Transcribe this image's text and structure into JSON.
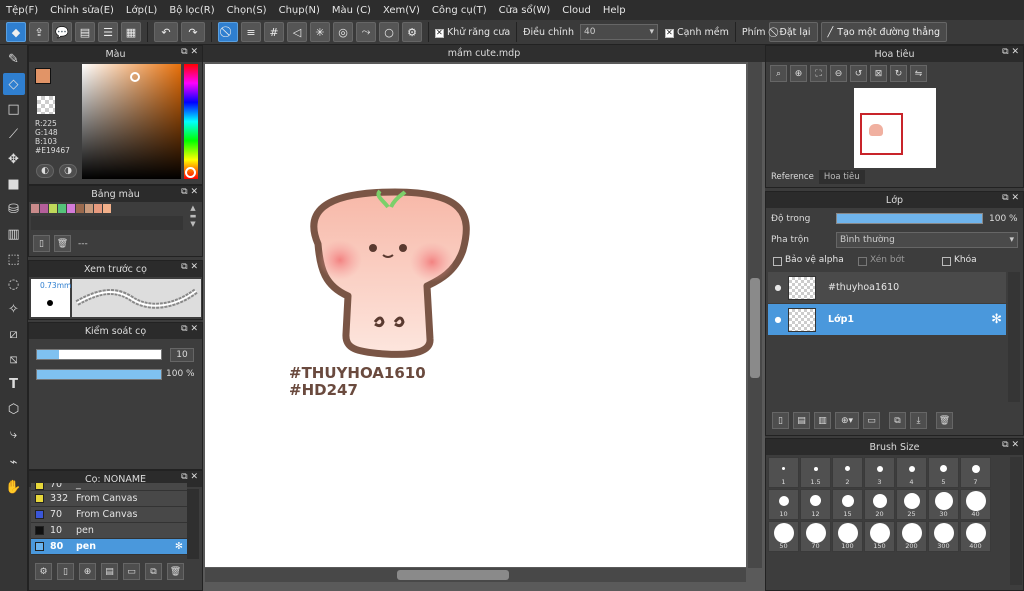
{
  "menu": [
    "Tệp(F)",
    "Chỉnh sửa(E)",
    "Lớp(L)",
    "Bộ lọc(R)",
    "Chọn(S)",
    "Chụp(N)",
    "Màu (C)",
    "Xem(V)",
    "Công cụ(T)",
    "Cửa sổ(W)",
    "Cloud",
    "Help"
  ],
  "toolbar": {
    "antialias_label": "Khử răng cưa",
    "adjust_label": "Điều chỉnh",
    "adjust_value": "40",
    "softedge_label": "Cạnh mềm",
    "keys_label": "Phím",
    "reset_label": "Đặt lại",
    "straight_label": "Tạo một đường thẳng"
  },
  "color_panel": {
    "title": "Màu",
    "r": "R:225",
    "g": "G:148",
    "b": "B:103",
    "hex": "#E19467",
    "fg_color": "#e19467"
  },
  "palette": {
    "title": "Bảng màu",
    "swatches": [
      "#c98a8a",
      "#b45f9a",
      "#c0d85a",
      "#55c37a",
      "#d37bd8",
      "#9a6a4e",
      "#c99a7c",
      "#e79a7e",
      "#f2b08a"
    ],
    "footer_text": "---"
  },
  "brush_preview": {
    "title": "Xem trước cọ",
    "size": "0.73mm"
  },
  "brush_control": {
    "title": "Kiểm soát cọ",
    "size_value": "10",
    "opacity_value": "100 %"
  },
  "brush_list": {
    "title": "Cọ: NONAME",
    "items": [
      {
        "color": "#e8d83a",
        "size": "70",
        "name": "_"
      },
      {
        "color": "#e8d83a",
        "size": "332",
        "name": "From Canvas"
      },
      {
        "color": "#3a56d8",
        "size": "70",
        "name": "From Canvas"
      },
      {
        "color": "#111111",
        "size": "10",
        "name": "pen"
      },
      {
        "color": "#6ab4f0",
        "size": "80",
        "name": "pen"
      }
    ]
  },
  "document": {
    "tab": "mầm cute.mdp",
    "text1": "#THUYHOA1610",
    "text2": "#HD247"
  },
  "navigator": {
    "title": "Hoa tiêu",
    "tab_reference": "Reference",
    "tab_navigator": "Hoa tiêu"
  },
  "layers": {
    "title": "Lớp",
    "opacity_label": "Độ trong",
    "opacity_value": "100 %",
    "blend_label": "Pha trộn",
    "blend_value": "Bình thường",
    "protect_alpha": "Bảo vệ alpha",
    "clipping": "Xén bớt",
    "lock": "Khóa",
    "items": [
      {
        "name": "#thuyhoa1610",
        "selected": false
      },
      {
        "name": "Lớp1",
        "selected": true
      }
    ]
  },
  "brush_size": {
    "title": "Brush Size",
    "sizes": [
      "1",
      "1.5",
      "2",
      "3",
      "4",
      "5",
      "7",
      "10",
      "12",
      "15",
      "20",
      "25",
      "30",
      "40",
      "50",
      "70",
      "100",
      "150",
      "200",
      "300",
      "400"
    ]
  }
}
